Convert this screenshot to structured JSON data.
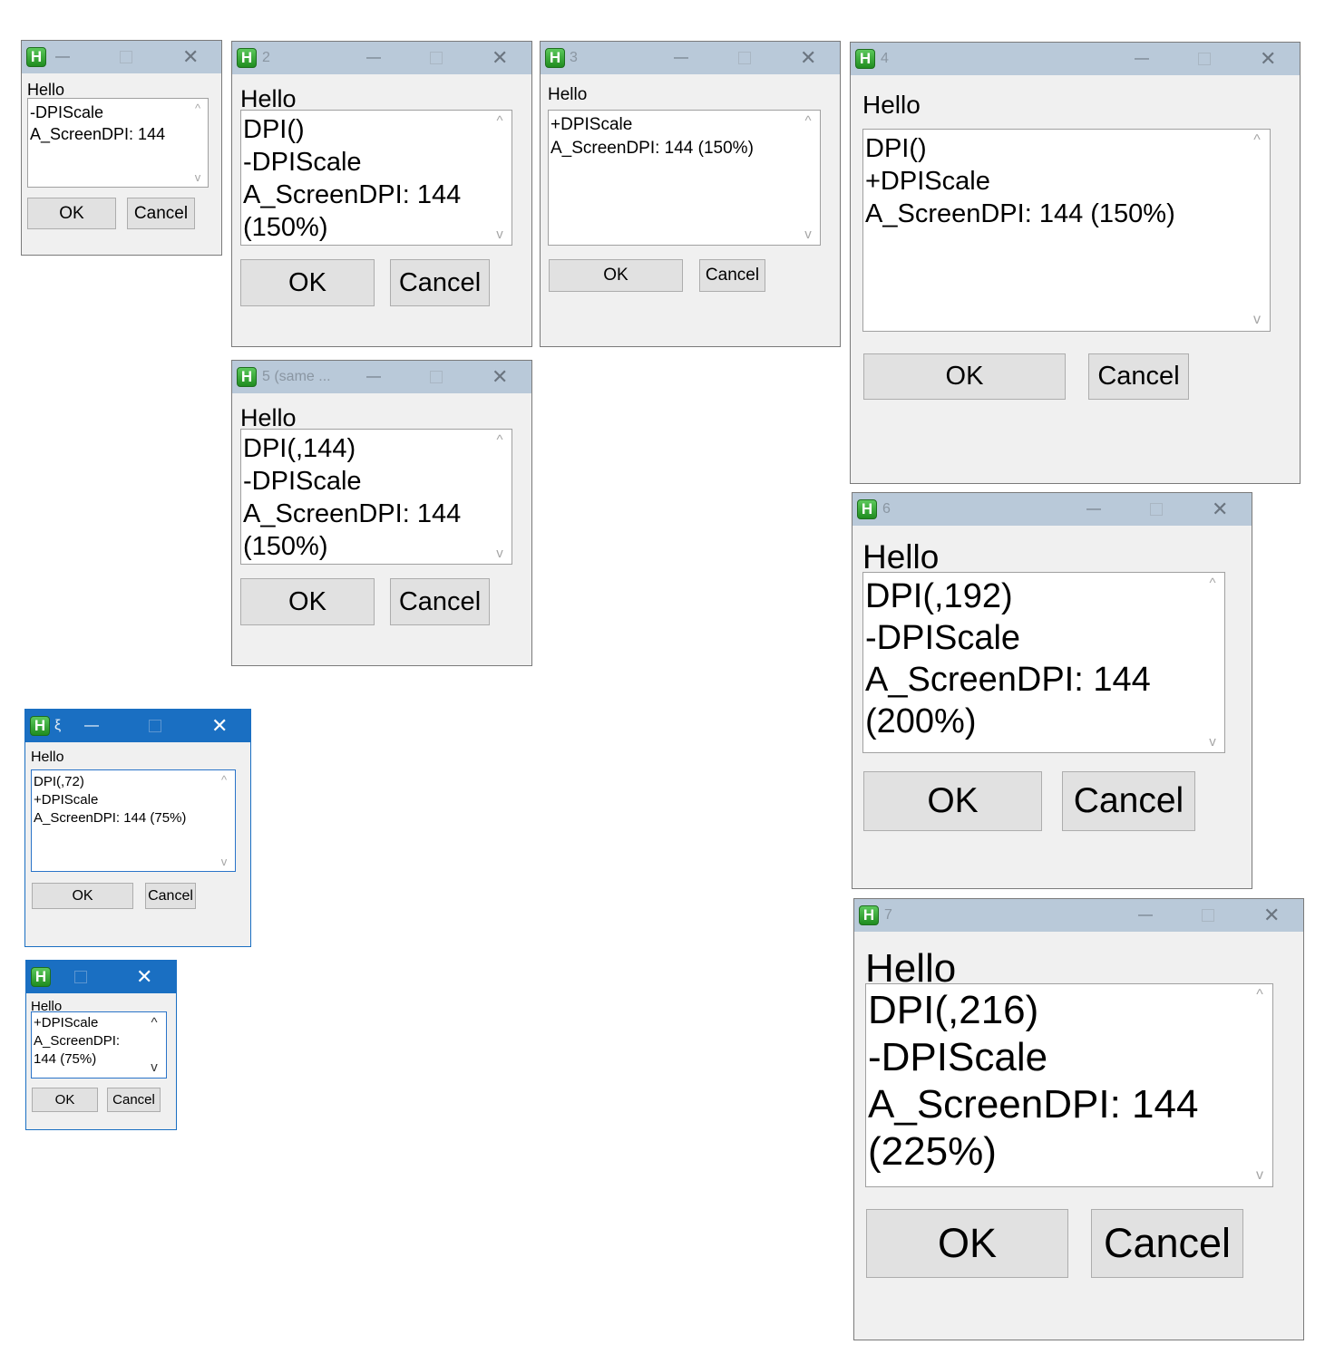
{
  "windows": {
    "w1": {
      "title": "",
      "label": "Hello",
      "edit_text": "-DPIScale\nA_ScreenDPI: 144",
      "ok": "OK",
      "cancel": "Cancel"
    },
    "w2": {
      "title": "2",
      "label": "Hello",
      "edit_text": "DPI()\n-DPIScale\nA_ScreenDPI: 144\n(150%)",
      "ok": "OK",
      "cancel": "Cancel"
    },
    "w3": {
      "title": "3",
      "label": "Hello",
      "edit_text": "+DPIScale\nA_ScreenDPI: 144 (150%)",
      "ok": "OK",
      "cancel": "Cancel"
    },
    "w4": {
      "title": "4",
      "label": "Hello",
      "edit_text": "DPI()\n+DPIScale\nA_ScreenDPI: 144 (150%)",
      "ok": "OK",
      "cancel": "Cancel"
    },
    "w5": {
      "title": "5 (same ...",
      "label": "Hello",
      "edit_text": "DPI(,144)\n-DPIScale\nA_ScreenDPI: 144\n(150%)",
      "ok": "OK",
      "cancel": "Cancel"
    },
    "w6": {
      "title": "6",
      "label": "Hello",
      "edit_text": "DPI(,192)\n-DPIScale\nA_ScreenDPI: 144\n(200%)",
      "ok": "OK",
      "cancel": "Cancel"
    },
    "w7": {
      "title": "7",
      "label": "Hello",
      "edit_text": "DPI(,216)\n-DPIScale\nA_ScreenDPI: 144\n(225%)",
      "ok": "OK",
      "cancel": "Cancel"
    },
    "w8": {
      "title": "ξ",
      "label": "Hello",
      "edit_text": "DPI(,72)\n+DPIScale\nA_ScreenDPI: 144 (75%)",
      "ok": "OK",
      "cancel": "Cancel"
    },
    "w9": {
      "title": "",
      "label": "Hello",
      "edit_text": "+DPIScale\nA_ScreenDPI:\n144 (75%)",
      "ok": "OK",
      "cancel": "Cancel"
    }
  },
  "glyphs": {
    "app_icon": "H",
    "minimize": "—",
    "close": "✕",
    "scroll_up": "^",
    "scroll_down": "v"
  },
  "icons": [
    "app-icon",
    "minimize-icon",
    "maximize-icon",
    "close-icon",
    "scroll-up-arrow",
    "scroll-down-arrow"
  ],
  "colors": {
    "inactive_titlebar": "#b9c9d9",
    "active_titlebar": "#1a6fc2",
    "window_bg": "#f0f0f0",
    "button_bg": "#e1e1e1",
    "icon_green": "#2fa12f"
  }
}
